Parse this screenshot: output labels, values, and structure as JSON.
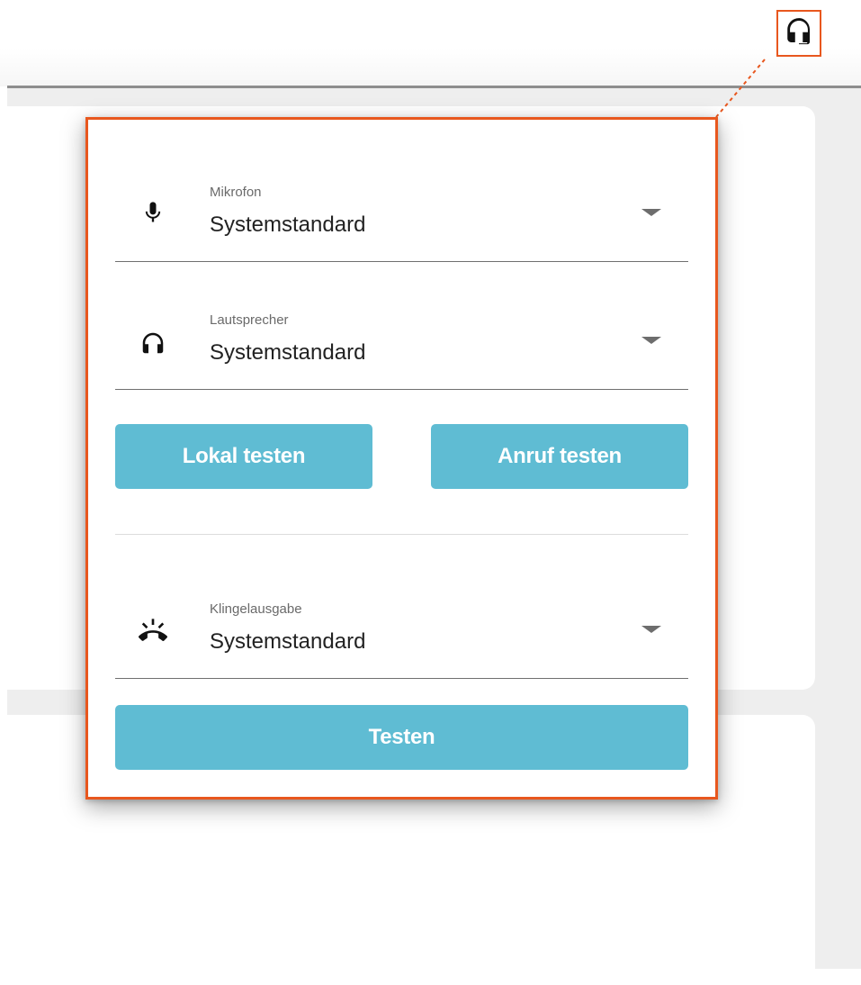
{
  "header": {
    "headset_button_icon": "headset-icon"
  },
  "audio_settings": {
    "microphone": {
      "icon": "microphone-icon",
      "label": "Mikrofon",
      "value": "Systemstandard"
    },
    "speaker": {
      "icon": "headphones-icon",
      "label": "Lautsprecher",
      "value": "Systemstandard"
    },
    "test_local_label": "Lokal testen",
    "test_call_label": "Anruf testen",
    "ringtone": {
      "icon": "ringing-phone-icon",
      "label": "Klingelausgabe",
      "value": "Systemstandard"
    },
    "test_label": "Testen"
  },
  "colors": {
    "accent": "#5fbcd3",
    "highlight": "#e8571e"
  }
}
